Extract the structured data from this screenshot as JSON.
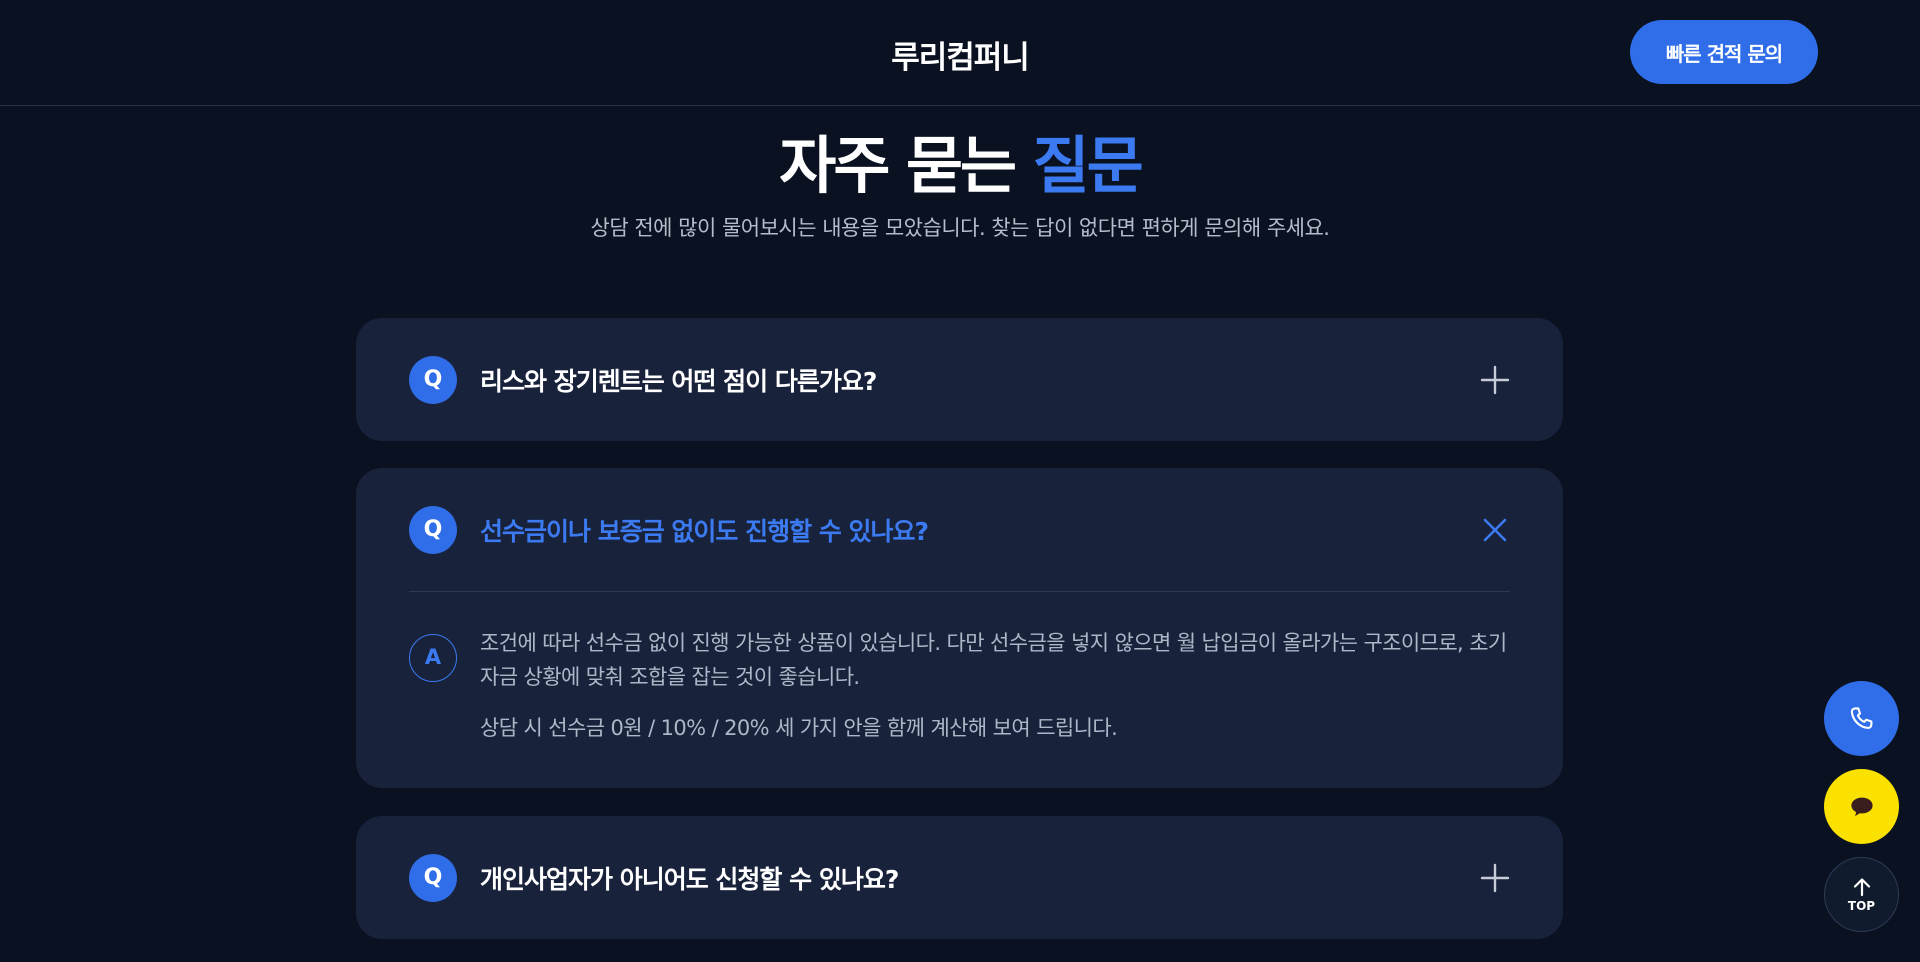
{
  "header": {
    "brand": "루리컴퍼니",
    "quote_button": "빠른 견적 문의"
  },
  "intro": {
    "title_main": "자주 묻는 ",
    "title_accent": "질문",
    "subtitle": "상담 전에 많이 물어보시는 내용을 모았습니다. 찾는 답이 없다면 편하게 문의해 주세요."
  },
  "faq": {
    "q_badge": "Q",
    "a_badge": "A",
    "items": [
      {
        "question": "리스와 장기렌트는 어떤 점이 다른가요?",
        "state": "collapsed"
      },
      {
        "question": "선수금이나 보증금 없이도 진행할 수 있나요?",
        "state": "expanded",
        "answer": "조건에 따라 선수금 없이 진행 가능한 상품이 있습니다. 다만 선수금을 넣지 않으면 월 납입금이 올라가는 구조이므로, 초기 자금 상황에 맞춰 조합을 잡는 것이 좋습니다.",
        "note": "상담 시 선수금 0원 / 10% / 20% 세 가지 안을 함께 계산해 보여 드립니다."
      },
      {
        "question": "개인사업자가 아니어도 신청할 수 있나요?",
        "state": "collapsed"
      }
    ]
  },
  "floating": {
    "top_label": "TOP"
  },
  "colors": {
    "background": "#0a1120",
    "card": "#18223b",
    "accent": "#2f6ee8",
    "kakao_yellow": "#fae100"
  }
}
